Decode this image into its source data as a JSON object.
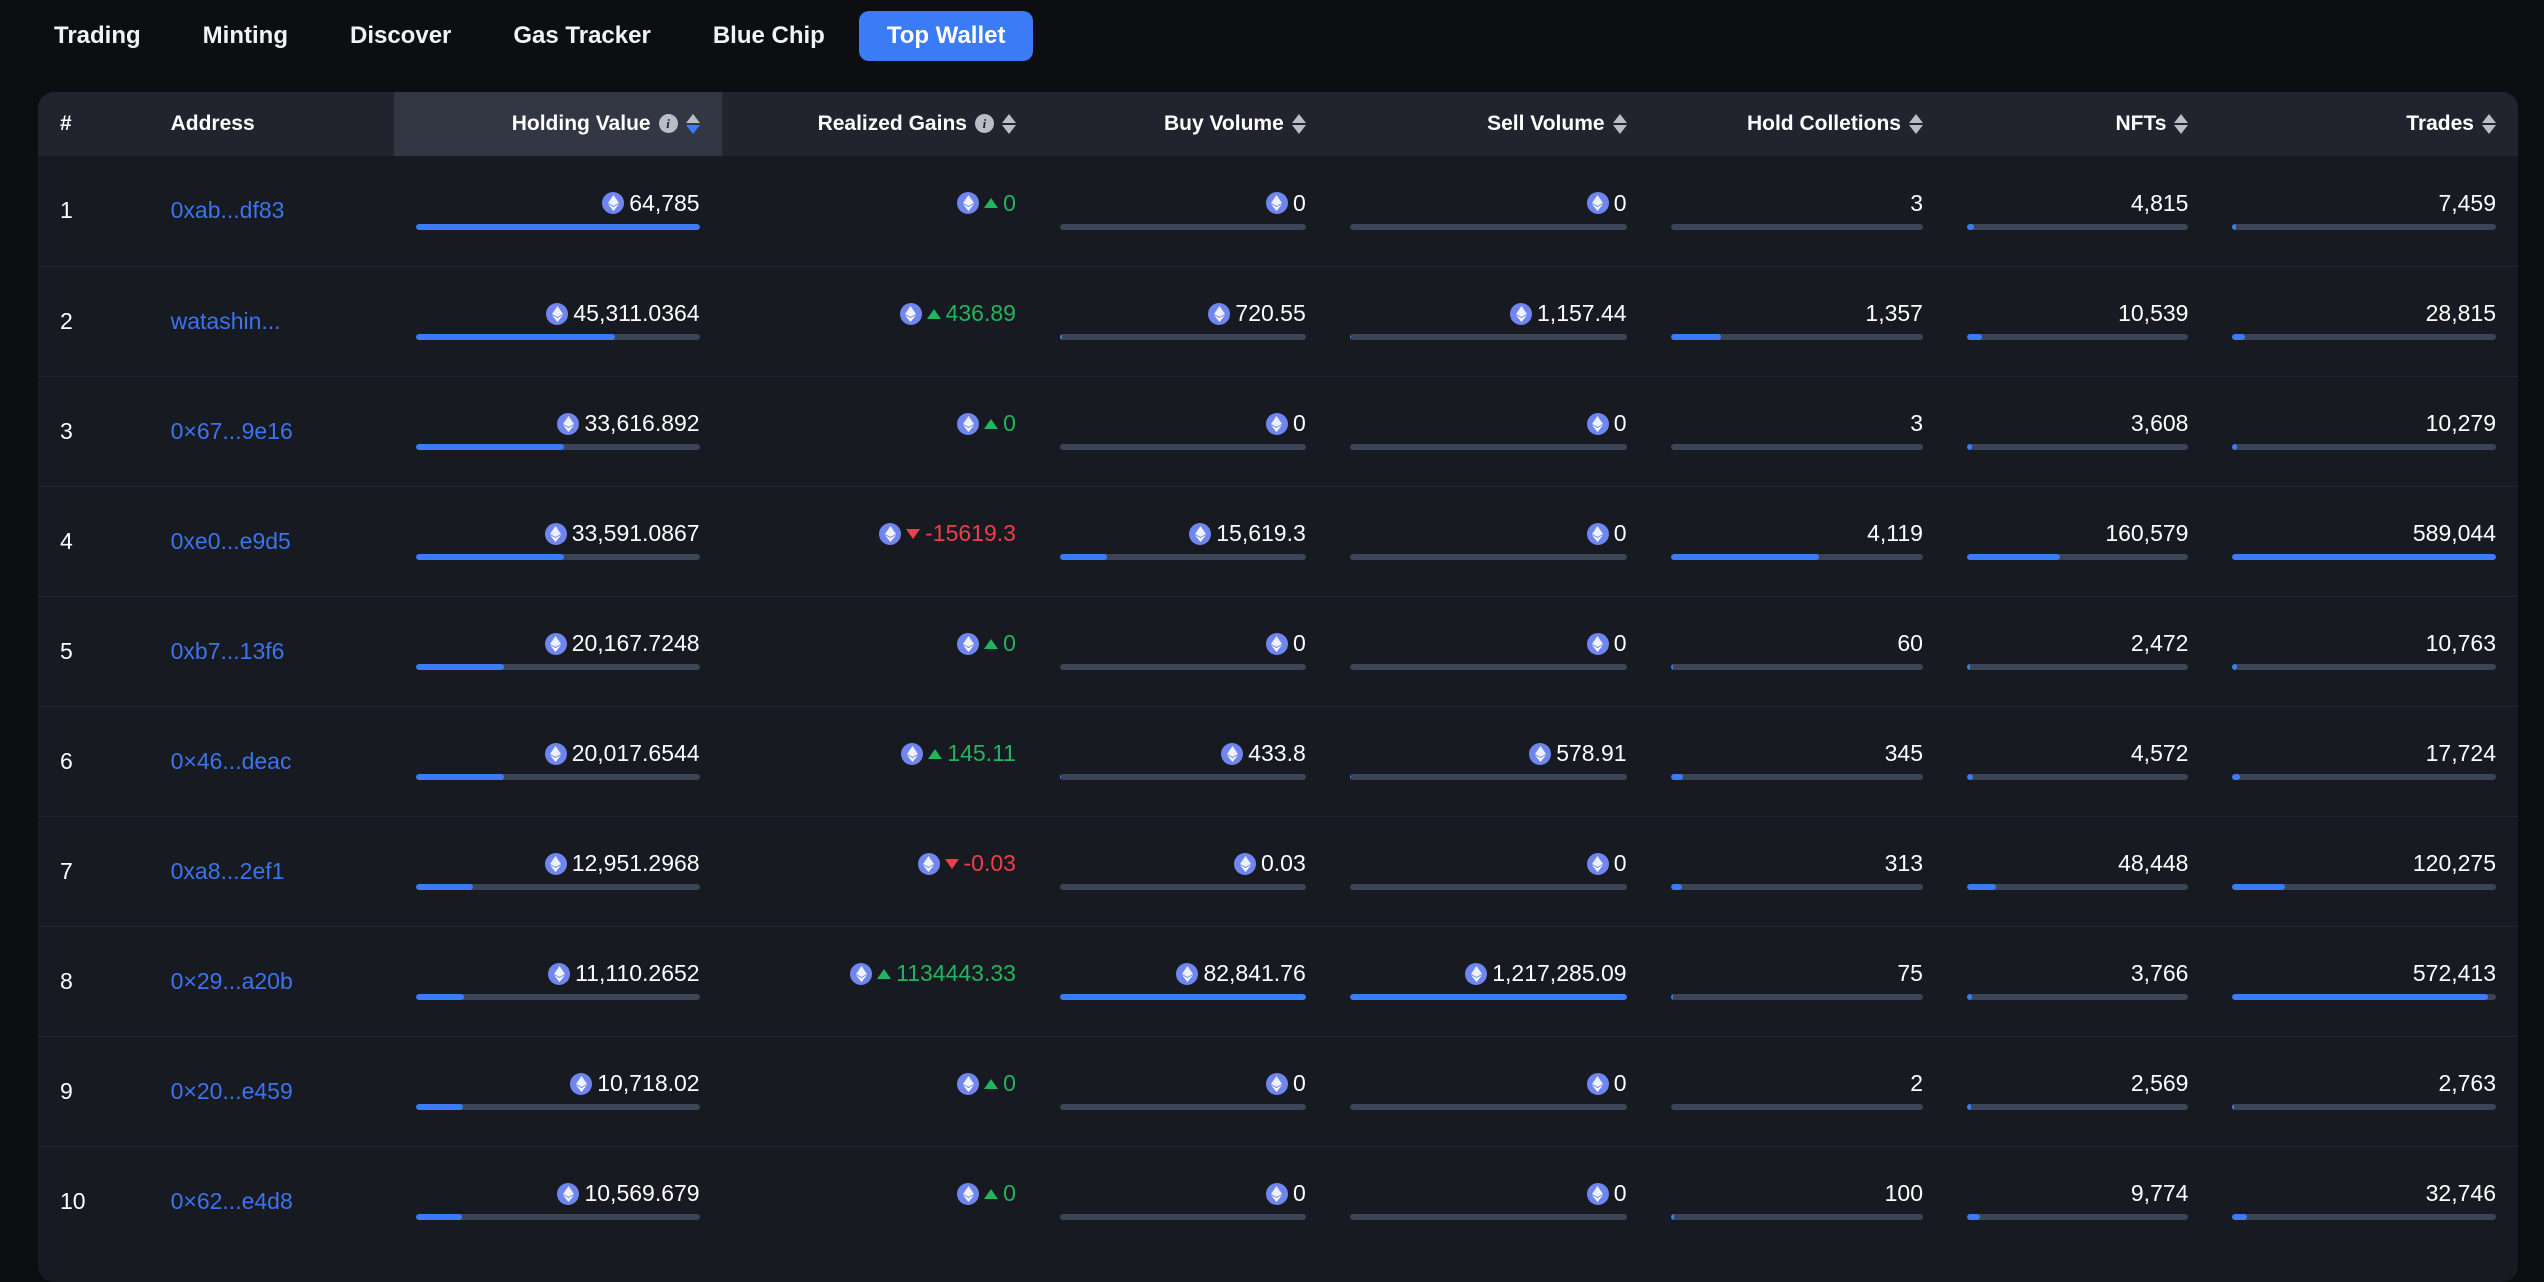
{
  "nav": {
    "items": [
      {
        "label": "Trading",
        "active": false
      },
      {
        "label": "Minting",
        "active": false
      },
      {
        "label": "Discover",
        "active": false
      },
      {
        "label": "Gas Tracker",
        "active": false
      },
      {
        "label": "Blue Chip",
        "active": false
      },
      {
        "label": "Top Wallet",
        "active": true
      }
    ]
  },
  "colors": {
    "accent": "#3b7cf6",
    "link": "#3b74ec",
    "positive": "#22b55e",
    "negative": "#f03e4a",
    "card_bg": "#181a21",
    "page_bg": "#0d0e12",
    "header_bg": "#21242e",
    "header_sorted_bg": "#323743",
    "bar_track": "#3c4558",
    "eth_token": "#6f86f0"
  },
  "table": {
    "columns": [
      {
        "key": "rank",
        "label": "#",
        "align": "left",
        "info": false,
        "sortable": false,
        "sorted": false,
        "sort_dir": ""
      },
      {
        "key": "addr",
        "label": "Address",
        "align": "left",
        "info": false,
        "sortable": false,
        "sorted": false,
        "sort_dir": ""
      },
      {
        "key": "hold",
        "label": "Holding Value",
        "align": "right",
        "info": true,
        "sortable": true,
        "sorted": true,
        "sort_dir": "desc"
      },
      {
        "key": "gain",
        "label": "Realized Gains",
        "align": "right",
        "info": true,
        "sortable": true,
        "sorted": false,
        "sort_dir": ""
      },
      {
        "key": "buy",
        "label": "Buy Volume",
        "align": "right",
        "info": false,
        "sortable": true,
        "sorted": false,
        "sort_dir": ""
      },
      {
        "key": "sell",
        "label": "Sell Volume",
        "align": "right",
        "info": false,
        "sortable": true,
        "sorted": false,
        "sort_dir": ""
      },
      {
        "key": "coll",
        "label": "Hold Colletions",
        "align": "right",
        "info": false,
        "sortable": true,
        "sorted": false,
        "sort_dir": ""
      },
      {
        "key": "nft",
        "label": "NFTs",
        "align": "right",
        "info": false,
        "sortable": true,
        "sorted": false,
        "sort_dir": ""
      },
      {
        "key": "trade",
        "label": "Trades",
        "align": "right",
        "info": false,
        "sortable": true,
        "sorted": false,
        "sort_dir": ""
      }
    ],
    "rows": [
      {
        "rank": "1",
        "address": "0xab...df83",
        "hold": {
          "text": "64,785",
          "eth": true,
          "bar": 100
        },
        "gain": {
          "text": "0",
          "eth": true,
          "trend": "up",
          "bar": null
        },
        "buy": {
          "text": "0",
          "eth": true,
          "bar": 0
        },
        "sell": {
          "text": "0",
          "eth": true,
          "bar": 0
        },
        "coll": {
          "text": "3",
          "eth": false,
          "bar": 0
        },
        "nft": {
          "text": "4,815",
          "eth": false,
          "bar": 3
        },
        "trade": {
          "text": "7,459",
          "eth": false,
          "bar": 1.3
        }
      },
      {
        "rank": "2",
        "address": "watashin...",
        "hold": {
          "text": "45,311.0364",
          "eth": true,
          "bar": 70
        },
        "gain": {
          "text": "436.89",
          "eth": true,
          "trend": "up",
          "bar": null
        },
        "buy": {
          "text": "720.55",
          "eth": true,
          "bar": 0.9
        },
        "sell": {
          "text": "1,157.44",
          "eth": true,
          "bar": 0.1
        },
        "coll": {
          "text": "1,357",
          "eth": false,
          "bar": 20
        },
        "nft": {
          "text": "10,539",
          "eth": false,
          "bar": 6.6
        },
        "trade": {
          "text": "28,815",
          "eth": false,
          "bar": 4.9
        }
      },
      {
        "rank": "3",
        "address": "0×67...9e16",
        "hold": {
          "text": "33,616.892",
          "eth": true,
          "bar": 52
        },
        "gain": {
          "text": "0",
          "eth": true,
          "trend": "up",
          "bar": null
        },
        "buy": {
          "text": "0",
          "eth": true,
          "bar": 0
        },
        "sell": {
          "text": "0",
          "eth": true,
          "bar": 0
        },
        "coll": {
          "text": "3",
          "eth": false,
          "bar": 0
        },
        "nft": {
          "text": "3,608",
          "eth": false,
          "bar": 2.2
        },
        "trade": {
          "text": "10,279",
          "eth": false,
          "bar": 1.7
        }
      },
      {
        "rank": "4",
        "address": "0xe0...e9d5",
        "hold": {
          "text": "33,591.0867",
          "eth": true,
          "bar": 52
        },
        "gain": {
          "text": "-15619.3",
          "eth": true,
          "trend": "down",
          "bar": null
        },
        "buy": {
          "text": "15,619.3",
          "eth": true,
          "bar": 19
        },
        "sell": {
          "text": "0",
          "eth": true,
          "bar": 0
        },
        "coll": {
          "text": "4,119",
          "eth": false,
          "bar": 59
        },
        "nft": {
          "text": "160,579",
          "eth": false,
          "bar": 42
        },
        "trade": {
          "text": "589,044",
          "eth": false,
          "bar": 100
        }
      },
      {
        "rank": "5",
        "address": "0xb7...13f6",
        "hold": {
          "text": "20,167.7248",
          "eth": true,
          "bar": 31
        },
        "gain": {
          "text": "0",
          "eth": true,
          "trend": "up",
          "bar": null
        },
        "buy": {
          "text": "0",
          "eth": true,
          "bar": 0
        },
        "sell": {
          "text": "0",
          "eth": true,
          "bar": 0
        },
        "coll": {
          "text": "60",
          "eth": false,
          "bar": 1
        },
        "nft": {
          "text": "2,472",
          "eth": false,
          "bar": 1.5
        },
        "trade": {
          "text": "10,763",
          "eth": false,
          "bar": 1.8
        }
      },
      {
        "rank": "6",
        "address": "0×46...deac",
        "hold": {
          "text": "20,017.6544",
          "eth": true,
          "bar": 31
        },
        "gain": {
          "text": "145.11",
          "eth": true,
          "trend": "up",
          "bar": null
        },
        "buy": {
          "text": "433.8",
          "eth": true,
          "bar": 0.5
        },
        "sell": {
          "text": "578.91",
          "eth": true,
          "bar": 0.05
        },
        "coll": {
          "text": "345",
          "eth": false,
          "bar": 5
        },
        "nft": {
          "text": "4,572",
          "eth": false,
          "bar": 2.8
        },
        "trade": {
          "text": "17,724",
          "eth": false,
          "bar": 3
        }
      },
      {
        "rank": "7",
        "address": "0xa8...2ef1",
        "hold": {
          "text": "12,951.2968",
          "eth": true,
          "bar": 20
        },
        "gain": {
          "text": "-0.03",
          "eth": true,
          "trend": "down",
          "bar": null
        },
        "buy": {
          "text": "0.03",
          "eth": true,
          "bar": 0
        },
        "sell": {
          "text": "0",
          "eth": true,
          "bar": 0
        },
        "coll": {
          "text": "313",
          "eth": false,
          "bar": 4.5
        },
        "nft": {
          "text": "48,448",
          "eth": false,
          "bar": 13
        },
        "trade": {
          "text": "120,275",
          "eth": false,
          "bar": 20
        }
      },
      {
        "rank": "8",
        "address": "0×29...a20b",
        "hold": {
          "text": "11,110.2652",
          "eth": true,
          "bar": 17
        },
        "gain": {
          "text": "1134443.33",
          "eth": true,
          "trend": "up",
          "bar": null
        },
        "buy": {
          "text": "82,841.76",
          "eth": true,
          "bar": 100
        },
        "sell": {
          "text": "1,217,285.09",
          "eth": true,
          "bar": 100
        },
        "coll": {
          "text": "75",
          "eth": false,
          "bar": 1.1
        },
        "nft": {
          "text": "3,766",
          "eth": false,
          "bar": 2.3
        },
        "trade": {
          "text": "572,413",
          "eth": false,
          "bar": 97
        }
      },
      {
        "rank": "9",
        "address": "0×20...e459",
        "hold": {
          "text": "10,718.02",
          "eth": true,
          "bar": 16.5
        },
        "gain": {
          "text": "0",
          "eth": true,
          "trend": "up",
          "bar": null
        },
        "buy": {
          "text": "0",
          "eth": true,
          "bar": 0
        },
        "sell": {
          "text": "0",
          "eth": true,
          "bar": 0
        },
        "coll": {
          "text": "2",
          "eth": false,
          "bar": 0
        },
        "nft": {
          "text": "2,569",
          "eth": false,
          "bar": 1.6
        },
        "trade": {
          "text": "2,763",
          "eth": false,
          "bar": 0.5
        }
      },
      {
        "rank": "10",
        "address": "0×62...e4d8",
        "hold": {
          "text": "10,569.679",
          "eth": true,
          "bar": 16
        },
        "gain": {
          "text": "0",
          "eth": true,
          "trend": "up",
          "bar": null
        },
        "buy": {
          "text": "0",
          "eth": true,
          "bar": 0
        },
        "sell": {
          "text": "0",
          "eth": true,
          "bar": 0
        },
        "coll": {
          "text": "100",
          "eth": false,
          "bar": 1.4
        },
        "nft": {
          "text": "9,774",
          "eth": false,
          "bar": 6
        },
        "trade": {
          "text": "32,746",
          "eth": false,
          "bar": 5.6
        }
      }
    ]
  }
}
